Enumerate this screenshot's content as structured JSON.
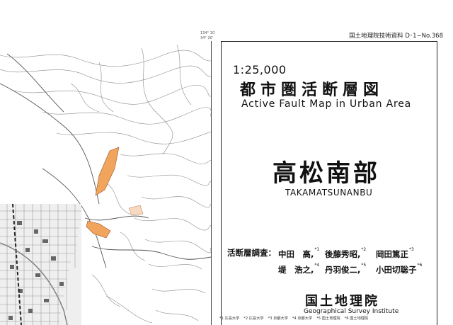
{
  "series": "国土地理院技術資料 D･1−No.368",
  "map": {
    "ticks": {
      "longitude": "134° 10′",
      "latitude": "34° 20′"
    },
    "colors": {
      "fault_zone": "#f0a45c",
      "fault_zone_light": "#f8d9c0",
      "contour": "#8a8a8a",
      "urban": "#b8b8b8"
    }
  },
  "title": {
    "scale": "1:25,000",
    "name_jp": "都市圏活断層図",
    "name_en": "Active Fault Map in Urban Area"
  },
  "sheet": {
    "name_jp": "高松南部",
    "name_en": "TAKAMATSUNANBU"
  },
  "survey": {
    "label": "活断層調査：",
    "people": [
      {
        "name": "中田　高,",
        "mark": "*1"
      },
      {
        "name": "後藤秀昭,",
        "mark": "*2"
      },
      {
        "name": "岡田篤正",
        "mark": "*3"
      },
      {
        "name": "堤　浩之,",
        "mark": "*4"
      },
      {
        "name": "丹羽俊二,",
        "mark": "*5"
      },
      {
        "name": "小田切聡子",
        "mark": "*6"
      }
    ]
  },
  "organization": {
    "name_jp": "国土地理院",
    "name_en": "Geographical Survey Institute"
  },
  "affiliations": [
    "*1 広島大学",
    "*2 広島大学",
    "*3 京都大学",
    "*4 京都大学",
    "*5 国土地理院",
    "*6 国土地理院"
  ]
}
